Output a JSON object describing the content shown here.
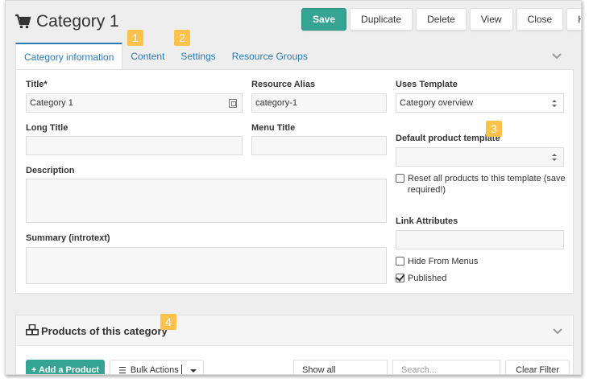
{
  "header": {
    "title": "Category 1"
  },
  "toolbar": {
    "save": "Save",
    "duplicate": "Duplicate",
    "delete": "Delete",
    "view": "View",
    "close": "Close",
    "help": "Help!"
  },
  "badges": [
    "1",
    "2",
    "3",
    "4"
  ],
  "tabs": [
    {
      "label": "Category information",
      "active": true
    },
    {
      "label": "Content"
    },
    {
      "label": "Settings"
    },
    {
      "label": "Resource Groups"
    }
  ],
  "form": {
    "title_label": "Title*",
    "title_value": "Category 1",
    "alias_label": "Resource Alias",
    "alias_value": "category-1",
    "template_label": "Uses Template",
    "template_value": "Category overview",
    "longtitle_label": "Long Title",
    "longtitle_value": "",
    "menutitle_label": "Menu Title",
    "menutitle_value": "",
    "default_product_template_label": "Default product template",
    "default_product_template_value": "",
    "reset_products_label": "Reset all products to this template (save required!)",
    "description_label": "Description",
    "description_value": "",
    "summary_label": "Summary (introtext)",
    "summary_value": "",
    "link_attributes_label": "Link Attributes",
    "link_attributes_value": "",
    "hide_from_menus_label": "Hide From Menus",
    "hide_from_menus_checked": false,
    "published_label": "Published",
    "published_checked": true,
    "reset_products_checked": false
  },
  "products": {
    "title": "Products of this category",
    "add_button": "+ Add a Product",
    "bulk_actions": "Bulk Actions",
    "show_filter": "Show all",
    "search_placeholder": "Search...",
    "clear_filter": "Clear Filter"
  },
  "colors": {
    "accent": "#35a493",
    "link": "#2a7ab8",
    "badge": "#fbc24c"
  }
}
